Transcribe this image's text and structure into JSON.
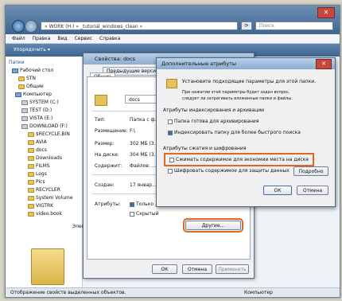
{
  "explorer": {
    "address": "« WORK (H:) » _tutorial_windows_clean »",
    "refresh_icon": "refresh-icon",
    "search_placeholder": "Поиск",
    "menu": [
      "Файл",
      "Правка",
      "Вид",
      "Сервис",
      "Справка"
    ],
    "organize_label": "Упорядочить ▾",
    "nav_header": "Папки",
    "tree": [
      {
        "label": "Рабочий стол",
        "icon": "desktop"
      },
      {
        "label": "STN",
        "icon": "folder"
      },
      {
        "label": "Общие",
        "icon": "folder"
      },
      {
        "label": "Компьютер",
        "icon": "computer"
      },
      {
        "label": "SYSTEM (C:)",
        "icon": "drive"
      },
      {
        "label": "TEST (D:)",
        "icon": "drive"
      },
      {
        "label": "VISTA (E:)",
        "icon": "drive"
      },
      {
        "label": "DOWNLOAD (F:)",
        "icon": "drive"
      },
      {
        "label": "$RECYCLE.BIN",
        "icon": "folder"
      },
      {
        "label": "AVIA",
        "icon": "folder"
      },
      {
        "label": "docs",
        "icon": "folder"
      },
      {
        "label": "Downloads",
        "icon": "folder"
      },
      {
        "label": "FILMS",
        "icon": "folder"
      },
      {
        "label": "Logs",
        "icon": "folder"
      },
      {
        "label": "Pics",
        "icon": "folder"
      },
      {
        "label": "RECYCLER",
        "icon": "folder"
      },
      {
        "label": "System Volume",
        "icon": "folder"
      },
      {
        "label": "VIGTRK",
        "icon": "folder"
      },
      {
        "label": "video.book",
        "icon": "folder"
      }
    ],
    "element_partial": "Элем",
    "status_left": "Отображение свойств выделенных объектов.",
    "status_right": "Компьютер"
  },
  "properties": {
    "title": "Свойства: docs",
    "tabs": [
      "Предыдущие версии",
      "Общие"
    ],
    "folder_name": "docs",
    "rows": [
      {
        "label": "Тип:",
        "value": "Папка с ф..."
      },
      {
        "label": "Размещение:",
        "value": "F:\\"
      },
      {
        "label": "Размер:",
        "value": "302 МБ (3..."
      },
      {
        "label": "На диске:",
        "value": "304 МБ (3..."
      },
      {
        "label": "Содержит:",
        "value": "Файлов: ..."
      },
      {
        "label": "Создан:",
        "value": "17 январ..."
      },
      {
        "label": "Атрибуты:",
        "value": ""
      }
    ],
    "attr_readonly": "Только ...",
    "attr_hidden": "Скрытый",
    "other_button": "Другие...",
    "ok_button": "ОК",
    "cancel_button": "Отмена",
    "apply_button": "Применить"
  },
  "advanced": {
    "title": "Дополнительные атрибуты",
    "intro_line1": "Установите подходящие параметры для этой папки.",
    "intro_line2": "При нажатии этой параметры будет задан вопрос,",
    "intro_line3": "следует ли затрагивать вложенные папки и файлы.",
    "index_group": "Атрибуты индексирования и архивации",
    "index_archive": "Папка готова для архивирования",
    "index_fast": "Индексировать папку для более быстрого поиска",
    "compress_group": "Атрибуты сжатия и шифрования",
    "compress": "Сжимать содержимое для экономии места на диске",
    "encrypt": "Шифровать содержимое для защиты данных",
    "details_button": "Подробно",
    "ok_button": "ОК",
    "cancel_button": "Отмена",
    "highlight_color": "#e4661f"
  }
}
